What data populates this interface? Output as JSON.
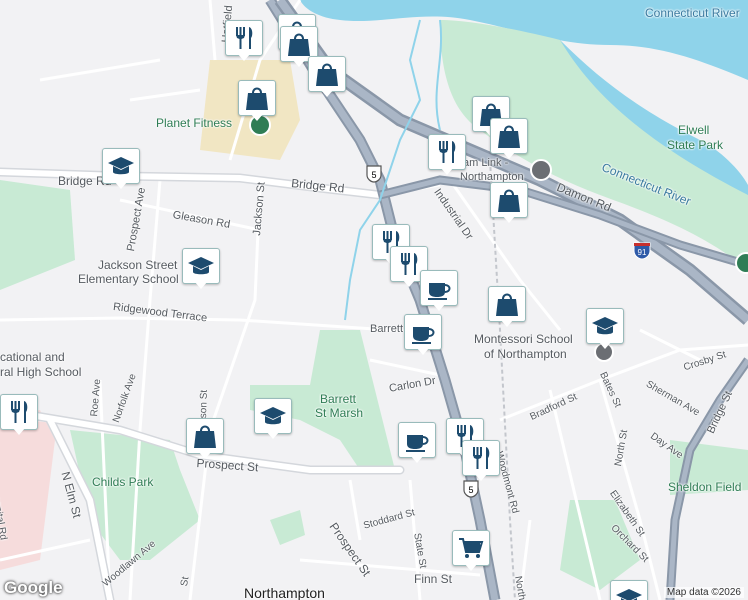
{
  "map": {
    "attribution": "Map data ©2026",
    "logo": "Google",
    "labels": {
      "connecticut_river_1": "Connecticut River",
      "connecticut_river_2": "Connecticut River",
      "elwell_1": "Elwell",
      "elwell_2": "State Park",
      "planet_fitness": "Planet Fitness",
      "hatfield": "Hatfield",
      "bridge_rd_w": "Bridge Rd",
      "bridge_rd_e": "Bridge Rd",
      "damon_rd": "Damon Rd",
      "adam_link_1": "am Link -",
      "adam_link_2": "Northampton",
      "industrial_dr": "Industrial Dr",
      "gleason_rd": "Gleason Rd",
      "prospect_ave": "Prospect Ave",
      "jackson_st": "Jackson St",
      "jackson_school_1": "Jackson Street",
      "jackson_school_2": "Elementary School",
      "ridgewood": "Ridgewood Terrace",
      "barrett": "Barrett",
      "montessori_1": "Montessori School",
      "montessori_2": "of Northampton",
      "vocational_1": "cational and",
      "vocational_2": "ral High School",
      "roe_ave": "Roe Ave",
      "norfolk_ave": "Norfolk Ave",
      "carlon_dr": "Carlon Dr",
      "barrett_marsh_1": "Barrett",
      "barrett_marsh_2": "St Marsh",
      "crosby_st": "Crosby St",
      "bradford_st": "Bradford St",
      "bates_st": "Bates St",
      "sherman_ave": "Sherman Ave",
      "day_ave": "Day Ave",
      "north_st": "North St",
      "bridge_st": "Bridge St",
      "sheldon": "Sheldon Field",
      "prospect_st_w": "Prospect St",
      "prospect_st_e": "Prospect St",
      "childs_park": "Childs Park",
      "n_elm_st": "N Elm St",
      "hospital_rd": "ospital Rd",
      "woodlawn": "Woodlawn Ave",
      "stoddard": "Stoddard St",
      "state_st": "State St",
      "woodmont": "Woodmont Rd",
      "elizabeth": "Elizabeth St",
      "orchard": "Orchard St",
      "finn_st": "Finn St",
      "northampton": "Northampton",
      "nson_st": "son St",
      "n_st_short": "St",
      "n_bottom": "North"
    },
    "shields": {
      "route5_a": "5",
      "route5_b": "5",
      "i91": "91"
    },
    "markers": [
      {
        "icon": "restaurant-icon",
        "name": "restaurant-marker-1"
      },
      {
        "icon": "shopping-bag-icon",
        "name": "shop-marker-1"
      },
      {
        "icon": "shopping-bag-icon",
        "name": "shop-marker-2"
      },
      {
        "icon": "shopping-bag-icon",
        "name": "shop-marker-3"
      },
      {
        "icon": "shopping-bag-icon",
        "name": "shop-marker-4"
      },
      {
        "icon": "shopping-bag-icon",
        "name": "shop-marker-5"
      },
      {
        "icon": "shopping-bag-icon",
        "name": "shop-marker-6"
      },
      {
        "icon": "restaurant-icon",
        "name": "restaurant-marker-2"
      },
      {
        "icon": "school-icon",
        "name": "school-marker-1"
      },
      {
        "icon": "shopping-bag-icon",
        "name": "shop-marker-7"
      },
      {
        "icon": "restaurant-icon",
        "name": "restaurant-marker-3"
      },
      {
        "icon": "restaurant-icon",
        "name": "restaurant-marker-4"
      },
      {
        "icon": "cafe-icon",
        "name": "cafe-marker-1"
      },
      {
        "icon": "school-icon",
        "name": "school-marker-2"
      },
      {
        "icon": "shopping-bag-icon",
        "name": "shop-marker-8"
      },
      {
        "icon": "cafe-icon",
        "name": "cafe-marker-2"
      },
      {
        "icon": "school-icon",
        "name": "school-marker-3"
      },
      {
        "icon": "restaurant-icon",
        "name": "restaurant-marker-5"
      },
      {
        "icon": "shopping-bag-icon",
        "name": "shop-marker-9"
      },
      {
        "icon": "school-icon",
        "name": "school-marker-4"
      },
      {
        "icon": "cafe-icon",
        "name": "cafe-marker-3"
      },
      {
        "icon": "restaurant-icon",
        "name": "restaurant-marker-6"
      },
      {
        "icon": "restaurant-icon",
        "name": "restaurant-marker-7"
      },
      {
        "icon": "grocery-cart-icon",
        "name": "grocery-marker-1"
      },
      {
        "icon": "school-icon",
        "name": "school-marker-5"
      }
    ]
  }
}
